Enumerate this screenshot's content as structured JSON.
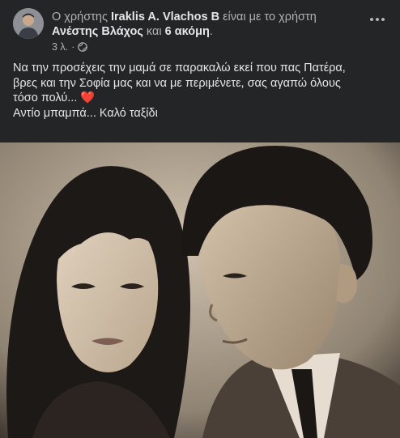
{
  "post": {
    "prefix": "Ο χρήστης",
    "author": "Iraklis A. Vlachos B",
    "with_text": "είναι με το χρήστη",
    "tagged_user": "Ανέστης Βλάχος",
    "and_text": "και",
    "others": "6 ακόμη",
    "period": ".",
    "time": "3 λ.",
    "separator": "·",
    "privacy_icon": "globe-icon",
    "text_line1": "Να την προσέχεις την μαμά σε παρακαλώ εκεί που πας Πατέρα,",
    "text_line2": "βρες και την Σοφία μας και να με περιμένετε, σας αγαπώ όλους",
    "text_line3": "τόσο πολύ...",
    "text_line4": "Αντίο μπαμπά... Καλό ταξίδι",
    "heart_emoji": "❤️"
  },
  "colors": {
    "background": "#242526",
    "primary_text": "#e4e6eb",
    "secondary_text": "#b0b3b8",
    "heart": "#e0245e"
  },
  "photo": {
    "description_icon": "vintage-couple-photo",
    "style": "sepia black-and-white"
  }
}
